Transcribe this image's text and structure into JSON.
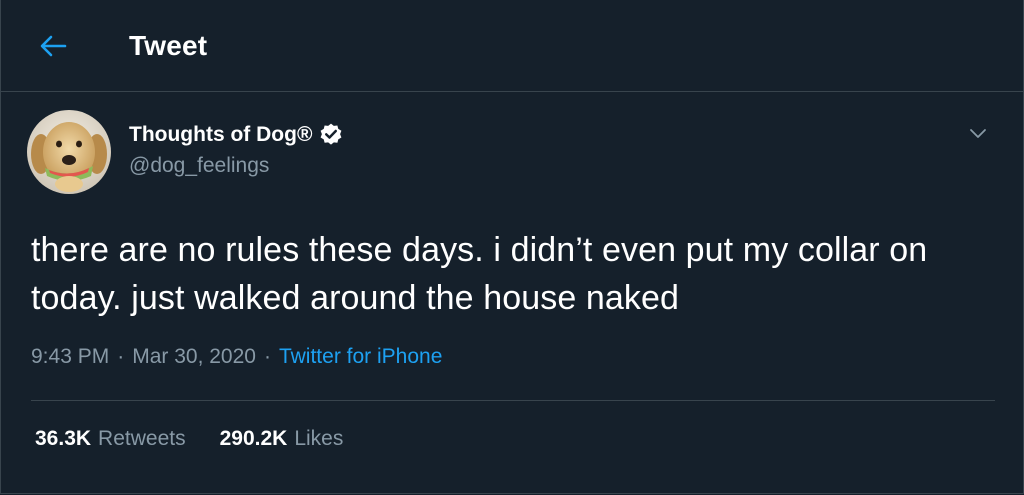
{
  "header": {
    "title": "Tweet",
    "back_icon": "arrow-left-icon"
  },
  "tweet": {
    "display_name": "Thoughts of Dog®",
    "handle": "@dog_feelings",
    "verified_icon": "verified-badge-icon",
    "menu_icon": "chevron-down-icon",
    "text": "there are no rules these days. i didn’t even put my collar on today. just walked around the house naked",
    "time": "9:43 PM",
    "separator": "·",
    "date": "Mar 30, 2020",
    "source": "Twitter for iPhone",
    "stats": {
      "retweets_count": "36.3K",
      "retweets_label": "Retweets",
      "likes_count": "290.2K",
      "likes_label": "Likes"
    }
  },
  "colors": {
    "background": "#15202b",
    "border": "#38444d",
    "accent": "#1da1f2",
    "secondary_text": "#8899a6",
    "primary_text": "#ffffff"
  }
}
